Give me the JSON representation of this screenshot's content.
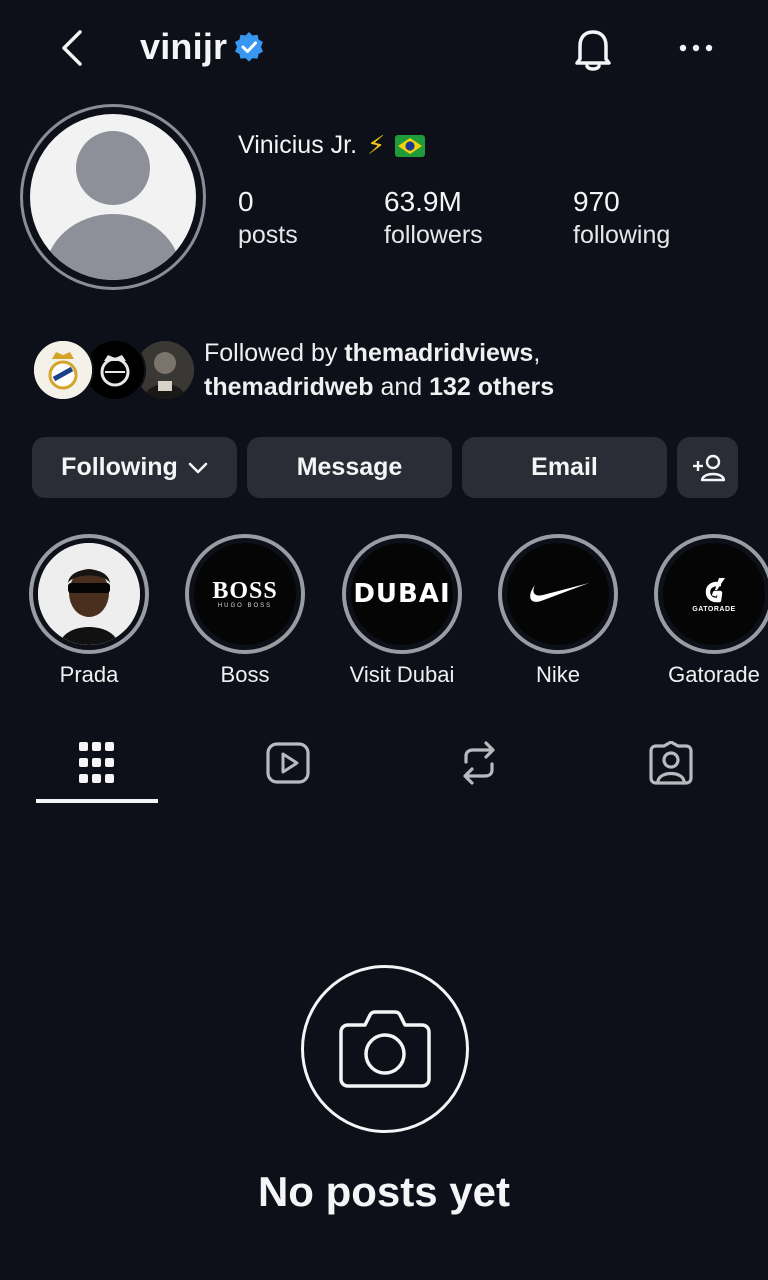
{
  "header": {
    "username": "vinijr",
    "back_icon": "chevron-left-icon",
    "bell_icon": "bell-icon",
    "more_icon": "more-horizontal-icon",
    "verified": true
  },
  "profile": {
    "full_name": "Vinicius Jr.",
    "emoji": [
      "⚡",
      "flag-brazil"
    ],
    "stats": [
      {
        "value": "0",
        "label": "posts"
      },
      {
        "value": "63.9M",
        "label": "followers"
      },
      {
        "value": "970",
        "label": "following"
      }
    ]
  },
  "followed_by": {
    "prefix": "Followed by",
    "user1": "themadridviews",
    "sep": ",",
    "user2": "themadridweb",
    "and": "and",
    "others": "132 others"
  },
  "actions": {
    "following": "Following",
    "message": "Message",
    "email": "Email"
  },
  "highlights": [
    {
      "label": "Prada"
    },
    {
      "label": "Boss",
      "logo": "BOSS",
      "sub": "HUGO BOSS"
    },
    {
      "label": "Visit Dubai",
      "logo": "DUBAI"
    },
    {
      "label": "Nike"
    },
    {
      "label": "Gatorade",
      "logo": "GATORADE"
    }
  ],
  "tabs": [
    "grid-icon",
    "reels-icon",
    "reposts-icon",
    "tagged-icon"
  ],
  "empty_state": {
    "text": "No posts yet"
  },
  "colors": {
    "background": "#0d1018",
    "button": "#2a2d35",
    "verified": "#3897f0"
  }
}
